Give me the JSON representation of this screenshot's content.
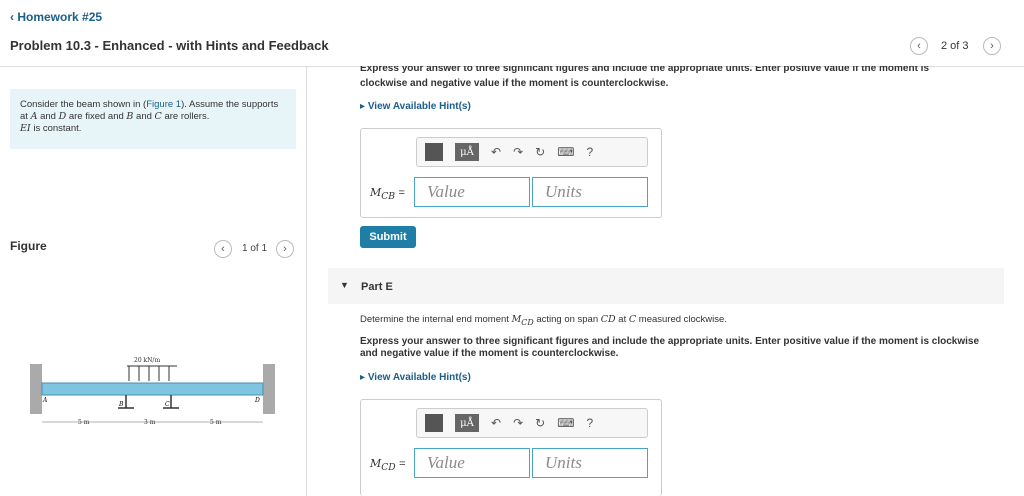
{
  "header": {
    "back_link": "Homework #25",
    "title": "Problem 10.3 - Enhanced - with Hints and Feedback",
    "page_counter": "2 of 3"
  },
  "intro": {
    "text_1": "Consider the beam shown in (",
    "figure_link": "Figure 1",
    "text_2": "). Assume the supports at ",
    "A": "A",
    "and": " and ",
    "D": "D",
    "text_3": " are fixed and ",
    "B": "B",
    "C": "C",
    "text_4": " are rollers.",
    "EI": "EI",
    "text_5": " is constant."
  },
  "figure": {
    "label": "Figure",
    "pager": "1 of 1",
    "load_label": "20 kN/m",
    "support_labels": [
      "A",
      "B",
      "C",
      "D"
    ],
    "dims": [
      "5 m",
      "3 m",
      "5 m"
    ]
  },
  "partD": {
    "instruction_top": "Express your answer to three significant figures and include the appropriate units. Enter positive value if the moment is",
    "instruction_bottom": "clockwise and negative value if the moment is counterclockwise.",
    "hint_link": "View Available Hint(s)",
    "var_label": "M",
    "var_sub": "CB",
    "eq": "=",
    "value_placeholder": "Value",
    "units_placeholder": "Units",
    "submit": "Submit"
  },
  "partE": {
    "heading": "Part E",
    "prompt_1": "Determine the internal end moment ",
    "prompt_var": "M",
    "prompt_var_sub": "CD",
    "prompt_2": " acting on span ",
    "prompt_span": "CD",
    "prompt_3": " at ",
    "prompt_at": "C",
    "prompt_4": " measured clockwise.",
    "instruction": "Express your answer to three significant figures and include the appropriate units. Enter positive value if the moment is clockwise and negative value if the moment is counterclockwise.",
    "hint_link": "View Available Hint(s)",
    "var_label": "M",
    "var_sub": "CD",
    "eq": "=",
    "value_placeholder": "Value",
    "units_placeholder": "Units"
  },
  "toolbar": {
    "mu_label": "μÅ",
    "help": "?"
  },
  "colors": {
    "link": "#1a5f8a",
    "submit_bg": "#1f7ea6",
    "intro_bg": "#e8f5f8",
    "input_border": "#4aa3c8",
    "beam": "#7fc4e0"
  }
}
